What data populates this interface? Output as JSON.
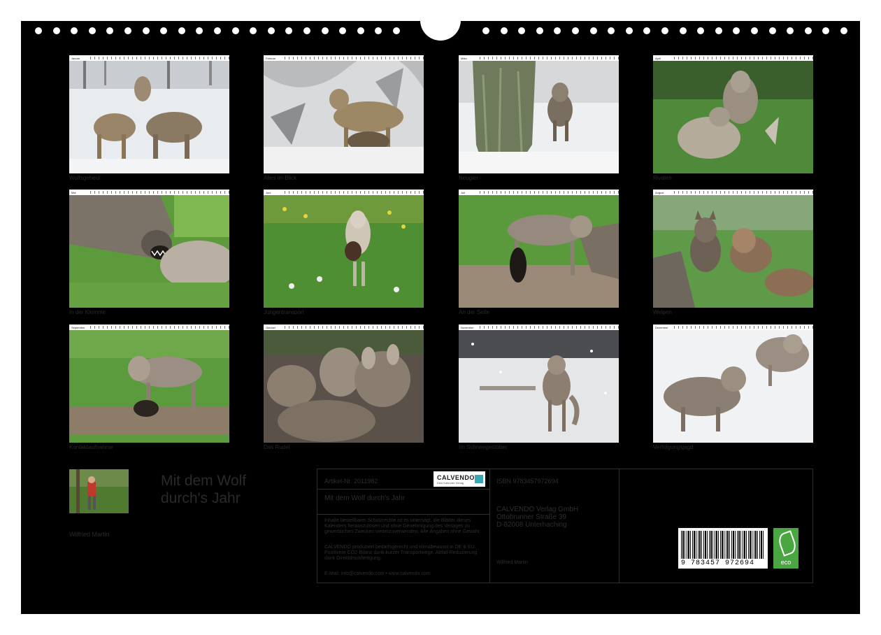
{
  "calendar": {
    "title_line1": "Mit dem Wolf",
    "title_line2": "durch's Jahr",
    "author": "Wilfried Martin"
  },
  "months": [
    {
      "month": "Januar",
      "caption": "Wolfsgeheul"
    },
    {
      "month": "Februar",
      "caption": "Alles im Blick"
    },
    {
      "month": "März",
      "caption": "Neugier"
    },
    {
      "month": "April",
      "caption": "Rivalen"
    },
    {
      "month": "Mai",
      "caption": "In der Klemme"
    },
    {
      "month": "Juni",
      "caption": "Jungentransport"
    },
    {
      "month": "Juli",
      "caption": "An der Seite"
    },
    {
      "month": "August",
      "caption": "Welpen"
    },
    {
      "month": "September",
      "caption": "Kontaktaufnahme"
    },
    {
      "month": "Oktober",
      "caption": "Das Rudel"
    },
    {
      "month": "November",
      "caption": "Im Schneegestöber"
    },
    {
      "month": "Dezember",
      "caption": "Verfolgungsjagd"
    }
  ],
  "infobox": {
    "article_no": "Artikel-Nr. 2011982",
    "calvendo_logo": "CALVENDO",
    "calvendo_tagline": "Dein Kalender-Verlag",
    "box_title": "Mit dem Wolf durch's Jahr",
    "legal_text": "Inhalte bestellbarer Schutzrechte ist es untersagt, die Blätter dieses Kalenders herauszulösen und ohne Genehmigung des Verlages zu gewerblichen Zwecken weiterzuverwenden. Alle Angaben ohne Gewähr.",
    "production_text": "CALVENDO produziert bedarfsgerecht und klimabewusst in DE & EU. Positivere CO2-Bilanz dank kurzer Transportwege. Abfall-Reduzierung dank Direktdruckfertigung.",
    "contact": "E-Mail: info@calvendo.com • www.calvendo.com",
    "isbn": "ISBN 9783457972694",
    "publisher_name": "CALVENDO Verlag GmbH",
    "publisher_street": "Ottobrunner Straße 39",
    "publisher_city": "D-82008 Unterhaching",
    "publisher_author": "Wilfried Martin",
    "barcode_number": "9 783457 972694",
    "eco_label": "eco"
  },
  "colors": {
    "page_background": "#000000",
    "eco_green": "#4aa640",
    "calvendo_accent": "#3aa6b5"
  }
}
